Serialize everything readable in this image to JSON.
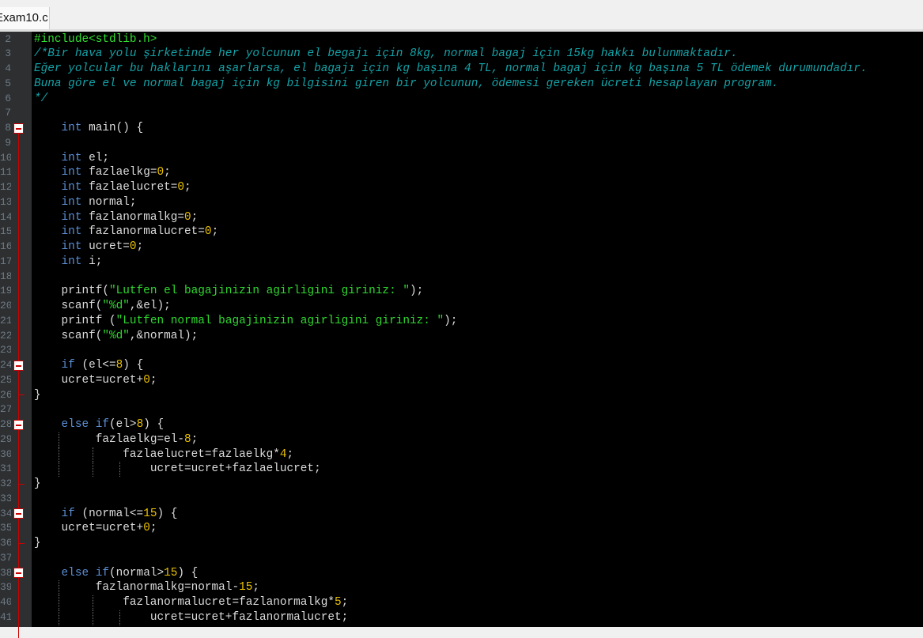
{
  "tab": {
    "label": "Exam10.c"
  },
  "colors": {
    "keyword": "#5b8fd6",
    "identifier": "#dcdcdc",
    "number": "#e8c000",
    "string": "#2ed82e",
    "comment": "#13a3a8",
    "fold_marker": "#cc0000"
  },
  "first_line_number": 2,
  "fold_lines": [
    8,
    24,
    28,
    34,
    38
  ],
  "fold_end_lines": [
    26,
    32,
    36
  ],
  "lines": [
    [
      [
        "p",
        "#include<stdlib.h>"
      ]
    ],
    [
      [
        "c",
        "/*Bir hava yolu şirketinde her yolcunun el begajı için 8kg, normal bagaj için 15kg hakkı bulunmaktadır."
      ]
    ],
    [
      [
        "c",
        "Eğer yolcular bu haklarını aşarlarsa, el bagajı için kg başına 4 TL, normal bagaj için kg başına 5 TL ödemek durumundadır."
      ]
    ],
    [
      [
        "c",
        "Buna göre el ve normal bagaj için kg bilgisini giren bir yolcunun, ödemesi gereken ücreti hesaplayan program."
      ]
    ],
    [
      [
        "c",
        "*/"
      ]
    ],
    [],
    [
      [
        "o",
        "    "
      ],
      [
        "k",
        "int"
      ],
      [
        "i",
        " main() {"
      ]
    ],
    [],
    [
      [
        "o",
        "    "
      ],
      [
        "k",
        "int"
      ],
      [
        "i",
        " el;"
      ]
    ],
    [
      [
        "o",
        "    "
      ],
      [
        "k",
        "int"
      ],
      [
        "i",
        " fazlaelkg="
      ],
      [
        "n",
        "0"
      ],
      [
        "i",
        ";"
      ]
    ],
    [
      [
        "o",
        "    "
      ],
      [
        "k",
        "int"
      ],
      [
        "i",
        " fazlaelucret="
      ],
      [
        "n",
        "0"
      ],
      [
        "i",
        ";"
      ]
    ],
    [
      [
        "o",
        "    "
      ],
      [
        "k",
        "int"
      ],
      [
        "i",
        " normal;"
      ]
    ],
    [
      [
        "o",
        "    "
      ],
      [
        "k",
        "int"
      ],
      [
        "i",
        " fazlanormalkg="
      ],
      [
        "n",
        "0"
      ],
      [
        "i",
        ";"
      ]
    ],
    [
      [
        "o",
        "    "
      ],
      [
        "k",
        "int"
      ],
      [
        "i",
        " fazlanormalucret="
      ],
      [
        "n",
        "0"
      ],
      [
        "i",
        ";"
      ]
    ],
    [
      [
        "o",
        "    "
      ],
      [
        "k",
        "int"
      ],
      [
        "i",
        " ucret="
      ],
      [
        "n",
        "0"
      ],
      [
        "i",
        ";"
      ]
    ],
    [
      [
        "o",
        "    "
      ],
      [
        "k",
        "int"
      ],
      [
        "i",
        " i;"
      ]
    ],
    [],
    [
      [
        "o",
        "    "
      ],
      [
        "i",
        "printf("
      ],
      [
        "s",
        "\"Lutfen el bagajinizin agirligini giriniz: \""
      ],
      [
        "i",
        ");"
      ]
    ],
    [
      [
        "o",
        "    "
      ],
      [
        "i",
        "scanf("
      ],
      [
        "s",
        "\"%d\""
      ],
      [
        "i",
        ",&el);"
      ]
    ],
    [
      [
        "o",
        "    "
      ],
      [
        "i",
        "printf ("
      ],
      [
        "s",
        "\"Lutfen normal bagajinizin agirligini giriniz: \""
      ],
      [
        "i",
        ");"
      ]
    ],
    [
      [
        "o",
        "    "
      ],
      [
        "i",
        "scanf("
      ],
      [
        "s",
        "\"%d\""
      ],
      [
        "i",
        ",&normal);"
      ]
    ],
    [],
    [
      [
        "o",
        "    "
      ],
      [
        "k",
        "if"
      ],
      [
        "i",
        " (el<="
      ],
      [
        "n",
        "8"
      ],
      [
        "i",
        ") {"
      ]
    ],
    [
      [
        "o",
        "    "
      ],
      [
        "i",
        "ucret=ucret+"
      ],
      [
        "n",
        "0"
      ],
      [
        "i",
        ";"
      ]
    ],
    [
      [
        "i",
        "}"
      ]
    ],
    [],
    [
      [
        "o",
        "    "
      ],
      [
        "k",
        "else"
      ],
      [
        "i",
        " "
      ],
      [
        "k",
        "if"
      ],
      [
        "i",
        "(el>"
      ],
      [
        "n",
        "8"
      ],
      [
        "i",
        ") {"
      ]
    ],
    [
      [
        "o",
        "         "
      ],
      [
        "i",
        "fazlaelkg=el-"
      ],
      [
        "n",
        "8"
      ],
      [
        "i",
        ";"
      ]
    ],
    [
      [
        "o",
        "             "
      ],
      [
        "i",
        "fazlaelucret=fazlaelkg*"
      ],
      [
        "n",
        "4"
      ],
      [
        "i",
        ";"
      ]
    ],
    [
      [
        "o",
        "                 "
      ],
      [
        "i",
        "ucret=ucret+fazlaelucret;"
      ]
    ],
    [
      [
        "i",
        "}"
      ]
    ],
    [],
    [
      [
        "o",
        "    "
      ],
      [
        "k",
        "if"
      ],
      [
        "i",
        " (normal<="
      ],
      [
        "n",
        "15"
      ],
      [
        "i",
        ") {"
      ]
    ],
    [
      [
        "o",
        "    "
      ],
      [
        "i",
        "ucret=ucret+"
      ],
      [
        "n",
        "0"
      ],
      [
        "i",
        ";"
      ]
    ],
    [
      [
        "i",
        "}"
      ]
    ],
    [],
    [
      [
        "o",
        "    "
      ],
      [
        "k",
        "else"
      ],
      [
        "i",
        " "
      ],
      [
        "k",
        "if"
      ],
      [
        "i",
        "(normal>"
      ],
      [
        "n",
        "15"
      ],
      [
        "i",
        ") {"
      ]
    ],
    [
      [
        "o",
        "         "
      ],
      [
        "i",
        "fazlanormalkg=normal-"
      ],
      [
        "n",
        "15"
      ],
      [
        "i",
        ";"
      ]
    ],
    [
      [
        "o",
        "             "
      ],
      [
        "i",
        "fazlanormalucret=fazlanormalkg*"
      ],
      [
        "n",
        "5"
      ],
      [
        "i",
        ";"
      ]
    ],
    [
      [
        "o",
        "                 "
      ],
      [
        "i",
        "ucret=ucret+fazlanormalucret;"
      ]
    ]
  ]
}
